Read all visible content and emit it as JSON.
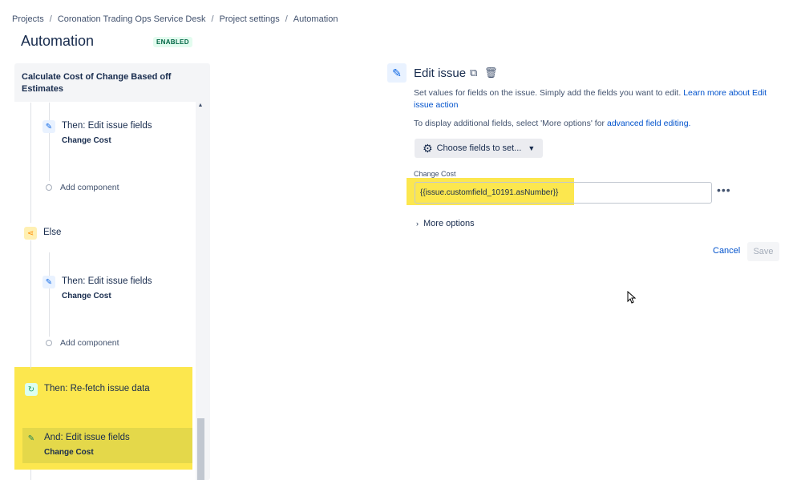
{
  "breadcrumb": {
    "items": [
      "Projects",
      "Coronation Trading Ops Service Desk",
      "Project settings",
      "Automation"
    ],
    "separator": "/"
  },
  "page": {
    "title": "Automation",
    "status_badge": "ENABLED"
  },
  "rule": {
    "name": "Calculate Cost of Change Based off Estimates",
    "steps": [
      {
        "kind": "action",
        "icon": "pencil-icon",
        "label": "Then: Edit issue fields",
        "detail": "Change Cost"
      },
      {
        "kind": "add",
        "label": "Add component"
      },
      {
        "kind": "branch",
        "icon": "branch-icon",
        "label": "Else"
      },
      {
        "kind": "action",
        "icon": "pencil-icon",
        "label": "Then: Edit issue fields",
        "detail": "Change Cost"
      },
      {
        "kind": "add",
        "label": "Add component"
      },
      {
        "kind": "action",
        "icon": "refresh-icon",
        "label": "Then: Re-fetch issue data"
      },
      {
        "kind": "action",
        "icon": "pencil-icon",
        "label": "And: Edit issue fields",
        "detail": "Change Cost"
      }
    ]
  },
  "editor": {
    "title": "Edit issue",
    "description": "Set values for fields on the issue. Simply add the fields you want to edit.",
    "learn_more": "Learn more about Edit issue action",
    "hint_prefix": "To display additional fields, select 'More options' for",
    "hint_link": "advanced field editing.",
    "choose_fields": "Choose fields to set...",
    "field_label": "Change Cost",
    "field_value": "{{issue.customfield_10191.asNumber}}",
    "more_options": "More options",
    "cancel": "Cancel",
    "save": "Save"
  },
  "colors": {
    "highlight": "#fce74e",
    "link": "#0052cc",
    "accent": "#0c66e4"
  }
}
